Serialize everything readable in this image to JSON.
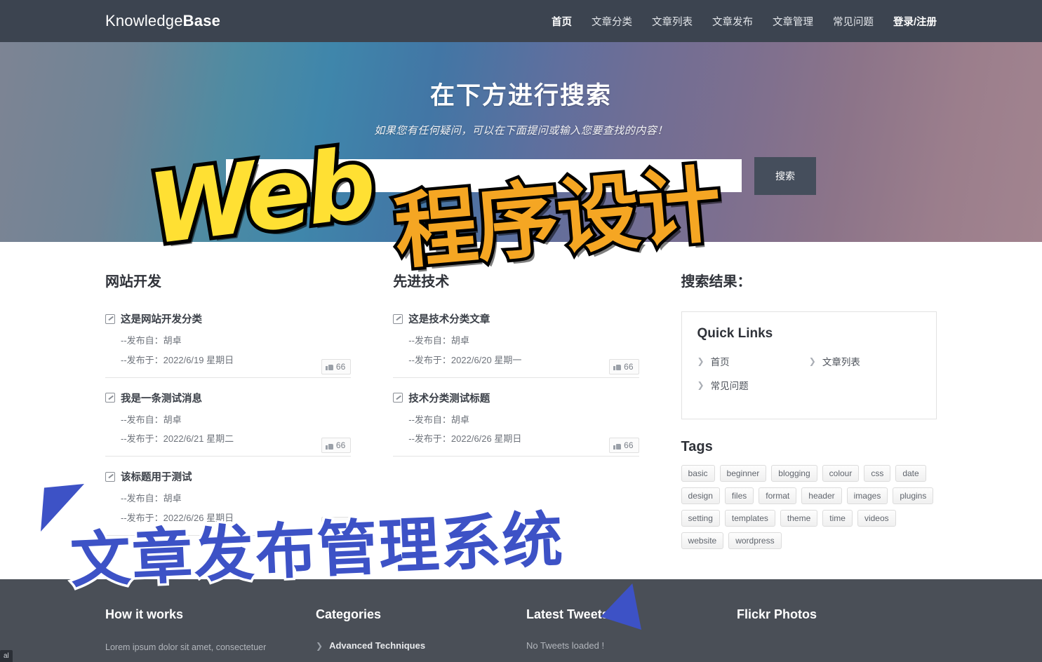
{
  "header": {
    "brand_light": "Knowledge",
    "brand_bold": "Base",
    "nav": [
      {
        "label": "首页",
        "style": "active"
      },
      {
        "label": "文章分类",
        "style": "normal"
      },
      {
        "label": "文章列表",
        "style": "normal"
      },
      {
        "label": "文章发布",
        "style": "normal"
      },
      {
        "label": "文章管理",
        "style": "normal"
      },
      {
        "label": "常见问题",
        "style": "normal"
      },
      {
        "label": "登录/注册",
        "style": "bold"
      }
    ]
  },
  "hero": {
    "title": "在下方进行搜索",
    "subtitle": "如果您有任何疑问，可以在下面提问或输入您要查找的内容！",
    "search_value": "",
    "search_placeholder": "",
    "search_button": "搜索"
  },
  "main": {
    "col1": {
      "heading": "网站开发",
      "posts": [
        {
          "title": "这是网站开发分类",
          "author": "--发布自：胡卓",
          "date": "--发布于：2022/6/19 星期日",
          "likes": "66"
        },
        {
          "title": "我是一条测试消息",
          "author": "--发布自：胡卓",
          "date": "--发布于：2022/6/21 星期二",
          "likes": "66"
        },
        {
          "title": "该标题用于测试",
          "author": "--发布自：胡卓",
          "date": "--发布于：2022/6/26 星期日",
          "likes": "66"
        }
      ]
    },
    "col2": {
      "heading": "先进技术",
      "posts": [
        {
          "title": "这是技术分类文章",
          "author": "--发布自：胡卓",
          "date": "--发布于：2022/6/20 星期一",
          "likes": "66"
        },
        {
          "title": "技术分类测试标题",
          "author": "--发布自：胡卓",
          "date": "--发布于：2022/6/26 星期日",
          "likes": "66"
        }
      ]
    },
    "sidebar": {
      "heading": "搜索结果：",
      "quick_links_title": "Quick Links",
      "quick_links": [
        "首页",
        "文章列表",
        "常见问题"
      ],
      "tags_title": "Tags",
      "tags": [
        "basic",
        "beginner",
        "blogging",
        "colour",
        "css",
        "date",
        "design",
        "files",
        "format",
        "header",
        "images",
        "plugins",
        "setting",
        "templates",
        "theme",
        "time",
        "videos",
        "website",
        "wordpress"
      ]
    }
  },
  "footer": {
    "col1_title": "How it works",
    "col1_text": "Lorem ipsum dolor sit amet, consectetuer",
    "col2_title": "Categories",
    "col2_item1": "Advanced Techniques",
    "col3_title": "Latest Tweets",
    "col3_text": "No Tweets loaded !",
    "col4_title": "Flickr Photos"
  },
  "overlay": {
    "word_en": "Web",
    "word_cn": "程序设计",
    "bottom_text": "文章发布管理系统",
    "color_yellow": "#FFE033",
    "color_orange": "#F5A623",
    "color_blue": "#3D52C6"
  },
  "taskchip": {
    "label": "al"
  }
}
